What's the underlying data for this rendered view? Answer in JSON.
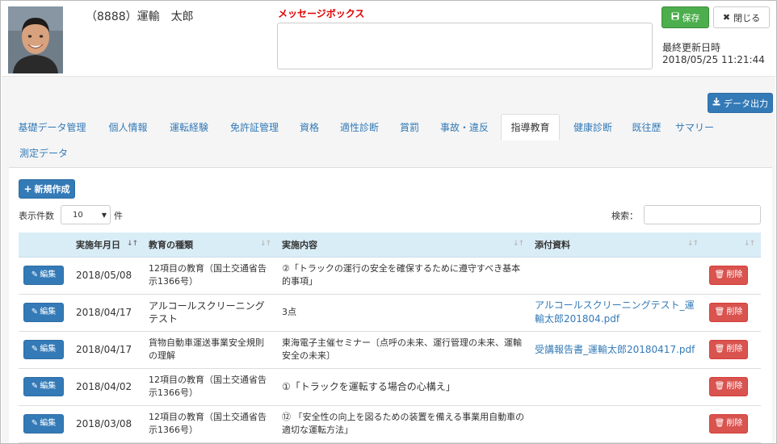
{
  "header": {
    "user_name": "（8888）運輸　太郎",
    "message_label": "メッセージボックス",
    "save_label": "保存",
    "close_label": "閉じる",
    "updated_label": "最終更新日時",
    "updated_value": "2018/05/25 11:21:44"
  },
  "toolbar": {
    "export_label": "データ出力"
  },
  "tabs": [
    {
      "label": "基礎データ管理"
    },
    {
      "label": "個人情報"
    },
    {
      "label": "運転経験"
    },
    {
      "label": "免許証管理"
    },
    {
      "label": "資格"
    },
    {
      "label": "適性診断"
    },
    {
      "label": "賞罰"
    },
    {
      "label": "事故・違反"
    },
    {
      "label": "指導教育"
    },
    {
      "label": "健康診断"
    },
    {
      "label": "既往歴"
    },
    {
      "label": "サマリー"
    },
    {
      "label": "測定データ"
    }
  ],
  "active_tab": "指導教育",
  "panel": {
    "new_label": "新規作成",
    "length_label": "表示件数",
    "length_value": "10",
    "length_unit": "件",
    "search_label": "検索：",
    "search_value": ""
  },
  "table": {
    "columns": [
      "",
      "実施年月日",
      "教育の種類",
      "実施内容",
      "添付資料",
      ""
    ],
    "edit_label": "編集",
    "delete_label": "削除",
    "rows": [
      {
        "date": "2018/05/08",
        "type": "12項目の教育（国土交通省告示1366号）",
        "content": "②「トラックの運行の安全を確保するために遵守すべき基本的事項」",
        "file": ""
      },
      {
        "date": "2018/04/17",
        "type": "アルコールスクリーニングテスト",
        "content": "3点",
        "file": "アルコールスクリーニングテスト_運輸太郎201804.pdf"
      },
      {
        "date": "2018/04/17",
        "type": "貨物自動車運送事業安全規則の理解",
        "content": "東海電子主催セミナー〔点呼の未来、運行管理の未来、運輸安全の未来〕",
        "file": "受講報告書_運輸太郎20180417.pdf"
      },
      {
        "date": "2018/04/02",
        "type": "12項目の教育（国土交通省告示1366号）",
        "content": "①「トラックを運転する場合の心構え」",
        "file": ""
      },
      {
        "date": "2018/03/08",
        "type": "12項目の教育（国土交通省告示1366号）",
        "content": "⑫ 「安全性の向上を図るための装置を備える事業用自動車の適切な運転方法」",
        "file": ""
      }
    ]
  },
  "colors": {
    "primary": "#337ab7",
    "success": "#4cae4c",
    "danger": "#d9534f",
    "message_label": "#e00000",
    "table_header": "#d9edf7"
  }
}
